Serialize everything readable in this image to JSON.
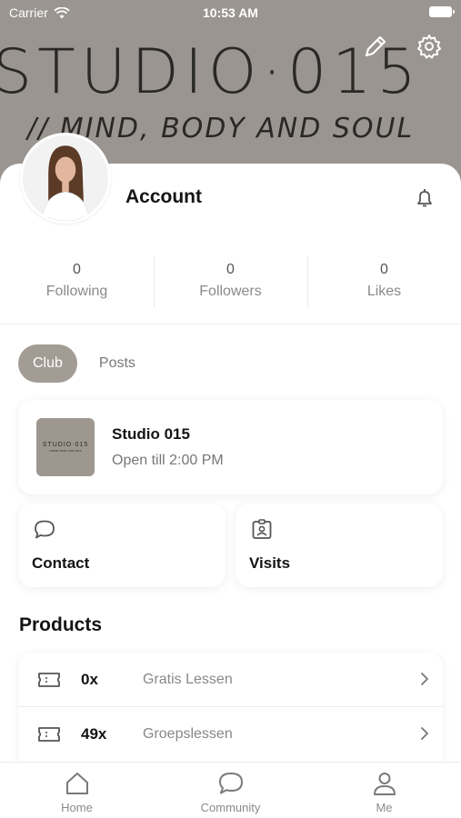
{
  "status_bar": {
    "carrier": "Carrier",
    "time": "10:53 AM"
  },
  "header": {
    "brand": "STUDIO·015",
    "tagline": "// MIND, BODY AND SOUL",
    "edit_icon": "pencil-icon",
    "settings_icon": "gear-icon"
  },
  "profile": {
    "title": "Account",
    "notification_icon": "bell-icon"
  },
  "stats": [
    {
      "value": "0",
      "label": "Following"
    },
    {
      "value": "0",
      "label": "Followers"
    },
    {
      "value": "0",
      "label": "Likes"
    }
  ],
  "tabs": [
    {
      "label": "Club",
      "active": true
    },
    {
      "label": "Posts",
      "active": false
    }
  ],
  "club": {
    "name": "Studio 015",
    "hours": "Open till 2:00 PM",
    "logo_text": "STUDIO·015",
    "logo_subtext": "// MIND, BODY AND SOUL"
  },
  "actions": [
    {
      "label": "Contact",
      "icon": "chat-bubble-icon"
    },
    {
      "label": "Visits",
      "icon": "badge-icon"
    }
  ],
  "products": {
    "title": "Products",
    "items": [
      {
        "count": "0x",
        "name": "Gratis Lessen"
      },
      {
        "count": "49x",
        "name": "Groepslessen"
      }
    ]
  },
  "tabbar": {
    "items": [
      {
        "label": "Home",
        "icon": "home-icon"
      },
      {
        "label": "Community",
        "icon": "chat-bubble-icon"
      },
      {
        "label": "Me",
        "icon": "person-icon"
      }
    ]
  },
  "colors": {
    "banner": "#9a9590",
    "accent": "#a39c95",
    "text": "#141414",
    "muted": "#888888"
  }
}
